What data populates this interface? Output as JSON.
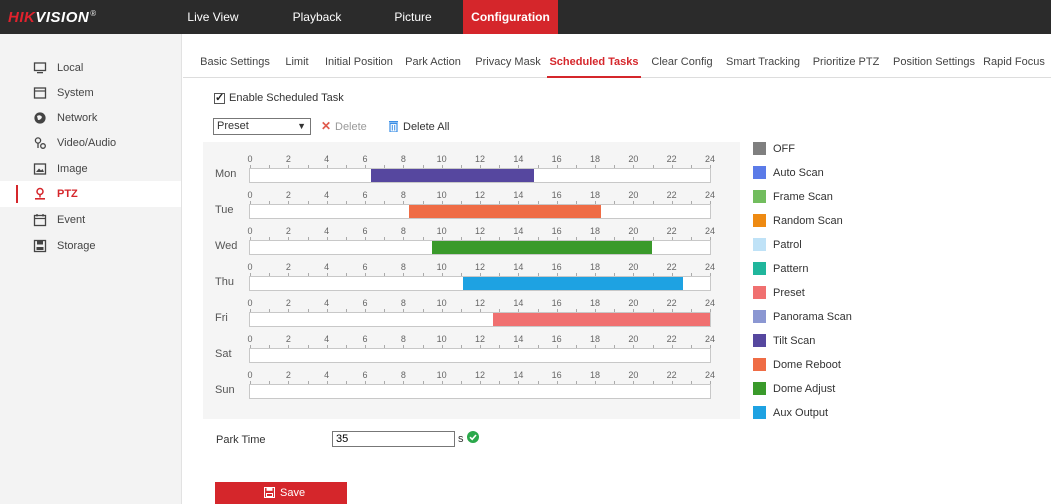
{
  "brand": {
    "name_accent": "HIK",
    "name_rest": "VISION",
    "mark": "®"
  },
  "nav": [
    "Live View",
    "Playback",
    "Picture",
    "Configuration"
  ],
  "nav_active": 3,
  "sidebar": {
    "items": [
      {
        "label": "Local",
        "icon": "monitor-icon"
      },
      {
        "label": "System",
        "icon": "system-icon"
      },
      {
        "label": "Network",
        "icon": "network-icon"
      },
      {
        "label": "Video/Audio",
        "icon": "video-audio-icon"
      },
      {
        "label": "Image",
        "icon": "image-icon"
      },
      {
        "label": "PTZ",
        "icon": "ptz-icon"
      },
      {
        "label": "Event",
        "icon": "event-icon"
      },
      {
        "label": "Storage",
        "icon": "storage-icon"
      }
    ],
    "active": 5
  },
  "tabs": [
    "Basic Settings",
    "Limit",
    "Initial Position",
    "Park Action",
    "Privacy Mask",
    "Scheduled Tasks",
    "Clear Config",
    "Smart Tracking",
    "Prioritize PTZ",
    "Position Settings",
    "Rapid Focus"
  ],
  "tab_active": 5,
  "enable_label": "Enable Scheduled Task",
  "enable_checked": true,
  "task_select": {
    "value": "Preset",
    "caret": "▼"
  },
  "delete_label": "Delete",
  "delete_all_label": "Delete All",
  "schedule": {
    "hour_ticks": [
      "0",
      "2",
      "4",
      "6",
      "8",
      "10",
      "12",
      "14",
      "16",
      "18",
      "20",
      "22",
      "24"
    ],
    "days": [
      {
        "day": "Mon",
        "tasks": [
          {
            "task": "Tilt Scan",
            "start": 6.3,
            "end": 14.8
          }
        ]
      },
      {
        "day": "Tue",
        "tasks": [
          {
            "task": "Dome Reboot",
            "start": 8.3,
            "end": 18.3
          }
        ]
      },
      {
        "day": "Wed",
        "tasks": [
          {
            "task": "Dome Adjust",
            "start": 9.5,
            "end": 21
          }
        ]
      },
      {
        "day": "Thu",
        "tasks": [
          {
            "task": "Aux Output",
            "start": 11.1,
            "end": 22.6
          }
        ]
      },
      {
        "day": "Fri",
        "tasks": [
          {
            "task": "Preset",
            "start": 12.7,
            "end": 24
          }
        ]
      },
      {
        "day": "Sat",
        "tasks": []
      },
      {
        "day": "Sun",
        "tasks": []
      }
    ]
  },
  "legend": [
    {
      "label": "OFF",
      "color": "#7f7f7f"
    },
    {
      "label": "Auto Scan",
      "color": "#5b7be8"
    },
    {
      "label": "Frame Scan",
      "color": "#72bd5e"
    },
    {
      "label": "Random Scan",
      "color": "#ee8a12"
    },
    {
      "label": "Patrol",
      "color": "#bfe2f7"
    },
    {
      "label": "Pattern",
      "color": "#20b69c"
    },
    {
      "label": "Preset",
      "color": "#f07070"
    },
    {
      "label": "Panorama Scan",
      "color": "#8b97d2"
    },
    {
      "label": "Tilt Scan",
      "color": "#56479f"
    },
    {
      "label": "Dome Reboot",
      "color": "#ef6c45"
    },
    {
      "label": "Dome Adjust",
      "color": "#3a9a2b"
    },
    {
      "label": "Aux Output",
      "color": "#1ea2e2"
    }
  ],
  "park_time": {
    "label": "Park Time",
    "value": "35",
    "unit": "s"
  },
  "save_label": "Save"
}
